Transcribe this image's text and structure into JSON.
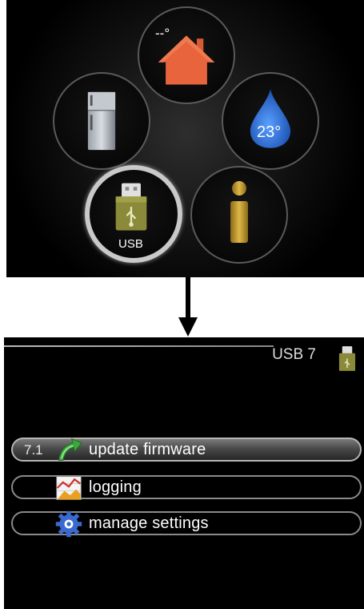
{
  "overview": {
    "outdoor_temp": "--°",
    "water_temp": "23°",
    "selected_label": "USB"
  },
  "usb_menu": {
    "title": "USB 7",
    "items": [
      {
        "number": "7.1",
        "label": "update firmware",
        "icon": "green-arrow-icon",
        "selected": true
      },
      {
        "number": "",
        "label": "logging",
        "icon": "chart-icon",
        "selected": false
      },
      {
        "number": "",
        "label": "manage settings",
        "icon": "gear-icon",
        "selected": false
      }
    ]
  },
  "colors": {
    "house": "#e8643c",
    "water_drop": "#2a6fd6",
    "usb_stick": "#8a8a3a",
    "info": "#c8a030",
    "selected_ring": "#c9c9c9"
  }
}
